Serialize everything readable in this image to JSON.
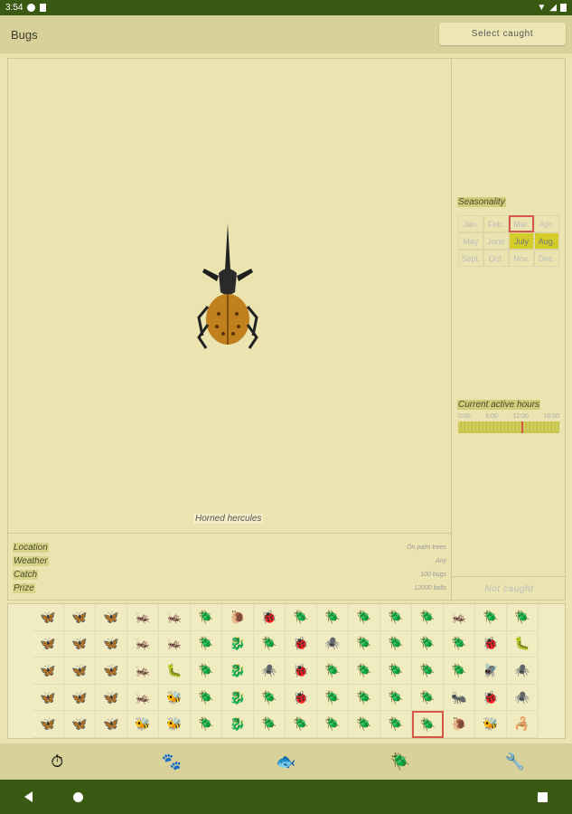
{
  "status": {
    "time": "3:54"
  },
  "appbar": {
    "title": "Bugs",
    "select_caught": "Select caught"
  },
  "detail": {
    "name": "Horned hercules",
    "info": [
      {
        "label": "Location",
        "value": "On palm trees"
      },
      {
        "label": "Weather",
        "value": "Any"
      },
      {
        "label": "Catch",
        "value": "100 bugs"
      },
      {
        "label": "Prize",
        "value": "12000 bells"
      }
    ],
    "seasonality_heading": "Seasonality",
    "months": [
      {
        "label": "Jan.",
        "active": false,
        "current": false
      },
      {
        "label": "Feb.",
        "active": false,
        "current": false
      },
      {
        "label": "Mar.",
        "active": false,
        "current": true
      },
      {
        "label": "Apr.",
        "active": false,
        "current": false
      },
      {
        "label": "May",
        "active": false,
        "current": false
      },
      {
        "label": "June",
        "active": false,
        "current": false
      },
      {
        "label": "July",
        "active": true,
        "current": false
      },
      {
        "label": "Aug.",
        "active": true,
        "current": false
      },
      {
        "label": "Sept.",
        "active": false,
        "current": false
      },
      {
        "label": "Oct.",
        "active": false,
        "current": false
      },
      {
        "label": "Nov.",
        "active": false,
        "current": false
      },
      {
        "label": "Dec.",
        "active": false,
        "current": false
      }
    ],
    "active_hours_heading": "Current active hours",
    "hour_labels": [
      "0:00",
      "6:00",
      "12:00",
      "18:00"
    ],
    "caught_status": "Not caught"
  },
  "grid": {
    "rows": [
      [
        "🦋",
        "🦋",
        "🦋",
        "🦗",
        "🦗",
        "🪲",
        "🐌",
        "🐞",
        "🪲",
        "🪲",
        "🪲",
        "🪲",
        "🪲",
        "🦗",
        "🪲",
        "🪲"
      ],
      [
        "🦋",
        "🦋",
        "🦋",
        "🦗",
        "🦗",
        "🪲",
        "🐉",
        "🪲",
        "🐞",
        "🕷️",
        "🪲",
        "🪲",
        "🪲",
        "🪲",
        "🐞",
        "🐛"
      ],
      [
        "🦋",
        "🦋",
        "🦋",
        "🦗",
        "🐛",
        "🪲",
        "🐉",
        "🕷️",
        "🐞",
        "🪲",
        "🪲",
        "🪲",
        "🪲",
        "🪲",
        "🪰",
        "🕷️"
      ],
      [
        "🦋",
        "🦋",
        "🦋",
        "🦗",
        "🐝",
        "🪲",
        "🐉",
        "🪲",
        "🐞",
        "🪲",
        "🪲",
        "🪲",
        "🪲",
        "🐜",
        "🐞",
        "🕷️"
      ],
      [
        "🦋",
        "🦋",
        "🦋",
        "🐝",
        "🐝",
        "🪲",
        "🐉",
        "🪲",
        "🪲",
        "🪲",
        "🪲",
        "🪲",
        "🪲",
        "🐌",
        "🐝",
        "🦂"
      ]
    ],
    "selected_row": 4,
    "selected_col": 12
  },
  "bottom_nav": [
    "timer-icon",
    "villager-icon",
    "fish-icon",
    "bug-icon",
    "wrench-icon"
  ]
}
